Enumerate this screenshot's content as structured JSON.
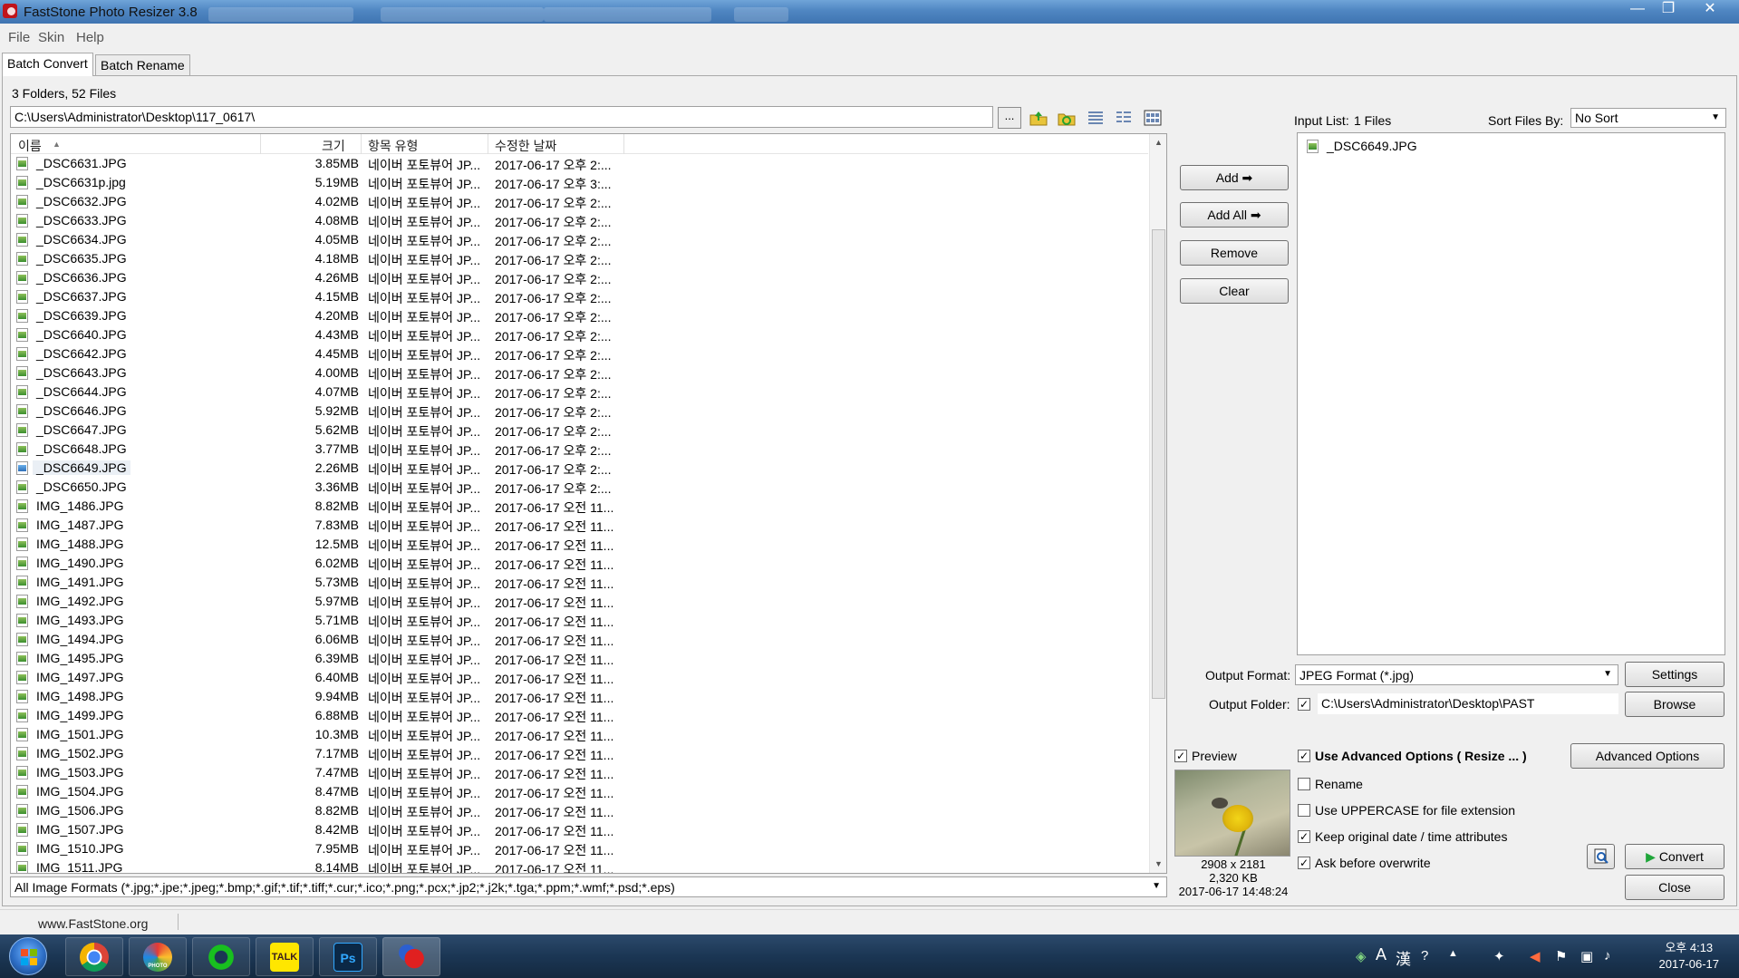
{
  "window": {
    "title": "FastStone Photo Resizer 3.8",
    "minimize": "—",
    "maximize": "❐",
    "close": "✕"
  },
  "menu": [
    "File",
    "Skin",
    "Help"
  ],
  "tabs": [
    "Batch Convert",
    "Batch Rename"
  ],
  "browser": {
    "summary": "3 Folders, 52 Files",
    "path": "C:\\Users\\Administrator\\Desktop\\117_0617\\",
    "browse_label": "...",
    "columns": [
      "이름",
      "크기",
      "항목 유형",
      "수정한 날짜"
    ],
    "files": [
      {
        "name": "_DSC6631.JPG",
        "size": "3.85MB",
        "type": "네이버 포토뷰어 JP...",
        "date": "2017-06-17 오후 2:..."
      },
      {
        "name": "_DSC6631p.jpg",
        "size": "5.19MB",
        "type": "네이버 포토뷰어 JP...",
        "date": "2017-06-17 오후 3:..."
      },
      {
        "name": "_DSC6632.JPG",
        "size": "4.02MB",
        "type": "네이버 포토뷰어 JP...",
        "date": "2017-06-17 오후 2:..."
      },
      {
        "name": "_DSC6633.JPG",
        "size": "4.08MB",
        "type": "네이버 포토뷰어 JP...",
        "date": "2017-06-17 오후 2:..."
      },
      {
        "name": "_DSC6634.JPG",
        "size": "4.05MB",
        "type": "네이버 포토뷰어 JP...",
        "date": "2017-06-17 오후 2:..."
      },
      {
        "name": "_DSC6635.JPG",
        "size": "4.18MB",
        "type": "네이버 포토뷰어 JP...",
        "date": "2017-06-17 오후 2:..."
      },
      {
        "name": "_DSC6636.JPG",
        "size": "4.26MB",
        "type": "네이버 포토뷰어 JP...",
        "date": "2017-06-17 오후 2:..."
      },
      {
        "name": "_DSC6637.JPG",
        "size": "4.15MB",
        "type": "네이버 포토뷰어 JP...",
        "date": "2017-06-17 오후 2:..."
      },
      {
        "name": "_DSC6639.JPG",
        "size": "4.20MB",
        "type": "네이버 포토뷰어 JP...",
        "date": "2017-06-17 오후 2:..."
      },
      {
        "name": "_DSC6640.JPG",
        "size": "4.43MB",
        "type": "네이버 포토뷰어 JP...",
        "date": "2017-06-17 오후 2:..."
      },
      {
        "name": "_DSC6642.JPG",
        "size": "4.45MB",
        "type": "네이버 포토뷰어 JP...",
        "date": "2017-06-17 오후 2:..."
      },
      {
        "name": "_DSC6643.JPG",
        "size": "4.00MB",
        "type": "네이버 포토뷰어 JP...",
        "date": "2017-06-17 오후 2:..."
      },
      {
        "name": "_DSC6644.JPG",
        "size": "4.07MB",
        "type": "네이버 포토뷰어 JP...",
        "date": "2017-06-17 오후 2:..."
      },
      {
        "name": "_DSC6646.JPG",
        "size": "5.92MB",
        "type": "네이버 포토뷰어 JP...",
        "date": "2017-06-17 오후 2:..."
      },
      {
        "name": "_DSC6647.JPG",
        "size": "5.62MB",
        "type": "네이버 포토뷰어 JP...",
        "date": "2017-06-17 오후 2:..."
      },
      {
        "name": "_DSC6648.JPG",
        "size": "3.77MB",
        "type": "네이버 포토뷰어 JP...",
        "date": "2017-06-17 오후 2:..."
      },
      {
        "name": "_DSC6649.JPG",
        "size": "2.26MB",
        "type": "네이버 포토뷰어 JP...",
        "date": "2017-06-17 오후 2:...",
        "selected": true
      },
      {
        "name": "_DSC6650.JPG",
        "size": "3.36MB",
        "type": "네이버 포토뷰어 JP...",
        "date": "2017-06-17 오후 2:..."
      },
      {
        "name": "IMG_1486.JPG",
        "size": "8.82MB",
        "type": "네이버 포토뷰어 JP...",
        "date": "2017-06-17 오전 11..."
      },
      {
        "name": "IMG_1487.JPG",
        "size": "7.83MB",
        "type": "네이버 포토뷰어 JP...",
        "date": "2017-06-17 오전 11..."
      },
      {
        "name": "IMG_1488.JPG",
        "size": "12.5MB",
        "type": "네이버 포토뷰어 JP...",
        "date": "2017-06-17 오전 11..."
      },
      {
        "name": "IMG_1490.JPG",
        "size": "6.02MB",
        "type": "네이버 포토뷰어 JP...",
        "date": "2017-06-17 오전 11..."
      },
      {
        "name": "IMG_1491.JPG",
        "size": "5.73MB",
        "type": "네이버 포토뷰어 JP...",
        "date": "2017-06-17 오전 11..."
      },
      {
        "name": "IMG_1492.JPG",
        "size": "5.97MB",
        "type": "네이버 포토뷰어 JP...",
        "date": "2017-06-17 오전 11..."
      },
      {
        "name": "IMG_1493.JPG",
        "size": "5.71MB",
        "type": "네이버 포토뷰어 JP...",
        "date": "2017-06-17 오전 11..."
      },
      {
        "name": "IMG_1494.JPG",
        "size": "6.06MB",
        "type": "네이버 포토뷰어 JP...",
        "date": "2017-06-17 오전 11..."
      },
      {
        "name": "IMG_1495.JPG",
        "size": "6.39MB",
        "type": "네이버 포토뷰어 JP...",
        "date": "2017-06-17 오전 11..."
      },
      {
        "name": "IMG_1497.JPG",
        "size": "6.40MB",
        "type": "네이버 포토뷰어 JP...",
        "date": "2017-06-17 오전 11..."
      },
      {
        "name": "IMG_1498.JPG",
        "size": "9.94MB",
        "type": "네이버 포토뷰어 JP...",
        "date": "2017-06-17 오전 11..."
      },
      {
        "name": "IMG_1499.JPG",
        "size": "6.88MB",
        "type": "네이버 포토뷰어 JP...",
        "date": "2017-06-17 오전 11..."
      },
      {
        "name": "IMG_1501.JPG",
        "size": "10.3MB",
        "type": "네이버 포토뷰어 JP...",
        "date": "2017-06-17 오전 11..."
      },
      {
        "name": "IMG_1502.JPG",
        "size": "7.17MB",
        "type": "네이버 포토뷰어 JP...",
        "date": "2017-06-17 오전 11..."
      },
      {
        "name": "IMG_1503.JPG",
        "size": "7.47MB",
        "type": "네이버 포토뷰어 JP...",
        "date": "2017-06-17 오전 11..."
      },
      {
        "name": "IMG_1504.JPG",
        "size": "8.47MB",
        "type": "네이버 포토뷰어 JP...",
        "date": "2017-06-17 오전 11..."
      },
      {
        "name": "IMG_1506.JPG",
        "size": "8.82MB",
        "type": "네이버 포토뷰어 JP...",
        "date": "2017-06-17 오전 11..."
      },
      {
        "name": "IMG_1507.JPG",
        "size": "8.42MB",
        "type": "네이버 포토뷰어 JP...",
        "date": "2017-06-17 오전 11..."
      },
      {
        "name": "IMG_1510.JPG",
        "size": "7.95MB",
        "type": "네이버 포토뷰어 JP...",
        "date": "2017-06-17 오전 11..."
      },
      {
        "name": "IMG_1511.JPG",
        "size": "8.14MB",
        "type": "네이버 포토뷰어 JP...",
        "date": "2017-06-17 오전 11..."
      }
    ],
    "filter": "All Image Formats (*.jpg;*.jpe;*.jpeg;*.bmp;*.gif;*.tif;*.tiff;*.cur;*.ico;*.png;*.pcx;*.jp2;*.j2k;*.tga;*.ppm;*.wmf;*.psd;*.eps)"
  },
  "actions": {
    "add": "Add ➡",
    "add_all": "Add All ➡",
    "remove": "Remove",
    "clear": "Clear"
  },
  "input_list": {
    "label": "Input List:",
    "count": "1 Files",
    "sort_label": "Sort Files By:",
    "sort_value": "No Sort",
    "items": [
      "_DSC6649.JPG"
    ]
  },
  "output": {
    "format_label": "Output Format:",
    "format_value": "JPEG Format (*.jpg)",
    "settings": "Settings",
    "folder_label": "Output Folder:",
    "folder_value": "C:\\Users\\Administrator\\Desktop\\PAST",
    "browse": "Browse"
  },
  "preview": {
    "label": "Preview",
    "dimensions": "2908 x 2181",
    "filesize": "2,320 KB",
    "timestamp": "2017-06-17 14:48:24"
  },
  "options": {
    "advanced": "Use Advanced Options ( Resize ... )",
    "advanced_button": "Advanced Options",
    "rename": "Rename",
    "uppercase": "Use UPPERCASE for file extension",
    "keep_date": "Keep original date / time attributes",
    "ask_overwrite": "Ask before overwrite",
    "checked": {
      "advanced": true,
      "rename": false,
      "uppercase": false,
      "keep_date": true,
      "ask_overwrite": true,
      "preview": true,
      "output_folder": true
    }
  },
  "bottom_buttons": {
    "convert": "Convert",
    "close": "Close"
  },
  "status": {
    "website": "www.FastStone.org"
  },
  "taskbar": {
    "apps": [
      "chrome-icon",
      "photoscape-icon",
      "line-icon",
      "kakaotalk-icon",
      "photoshop-icon",
      "faststone-icon"
    ],
    "kakao_label": "TALK",
    "ps_label": "Ps",
    "photoscape_label": "PHOTO SCAPE",
    "ime": [
      "A",
      "漢"
    ],
    "time": "오후 4:13",
    "date": "2017-06-17"
  },
  "colors": {
    "titlebar": "#4f86c2",
    "taskbar": "#1b3654",
    "accent_green": "#1fa63a"
  }
}
